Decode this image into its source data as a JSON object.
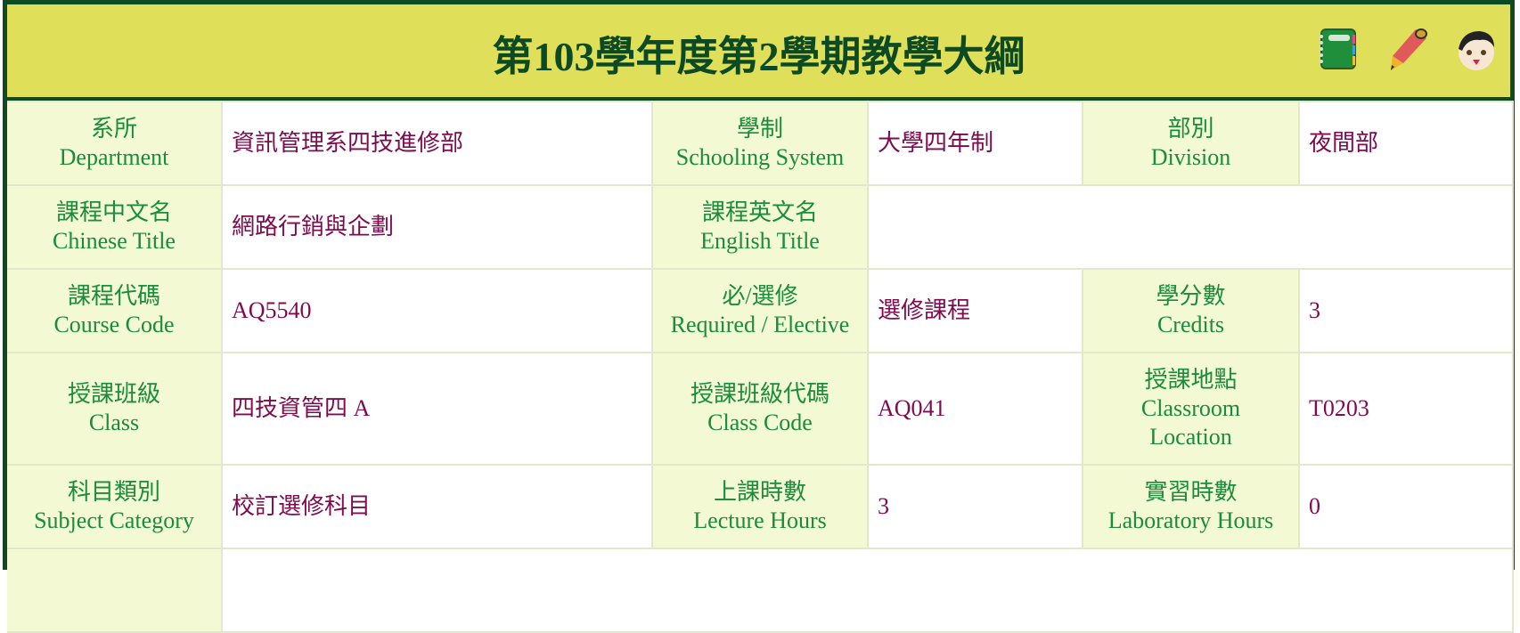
{
  "header": {
    "title": "第103學年度第2學期教學大綱",
    "icons": [
      "notebook-icon",
      "pencil-icon",
      "face-icon"
    ]
  },
  "colors": {
    "header_bg": "#dfdf5a",
    "border": "#0b4a22",
    "label": "#1a8c3c",
    "value": "#7e0b4e",
    "label_bg": "#f2f9d3"
  },
  "rows": [
    [
      {
        "zh": "系所",
        "en": "Department",
        "value": "資訊管理系四技進修部"
      },
      {
        "zh": "學制",
        "en": "Schooling System",
        "value": "大學四年制"
      },
      {
        "zh": "部別",
        "en": "Division",
        "value": "夜間部"
      }
    ],
    [
      {
        "zh": "課程中文名",
        "en": "Chinese Title",
        "value": "網路行銷與企劃"
      },
      {
        "zh": "課程英文名",
        "en": "English Title",
        "value": ""
      }
    ],
    [
      {
        "zh": "課程代碼",
        "en": "Course Code",
        "value": "AQ5540"
      },
      {
        "zh": "必/選修",
        "en": "Required / Elective",
        "value": "選修課程"
      },
      {
        "zh": "學分數",
        "en": "Credits",
        "value": "3"
      }
    ],
    [
      {
        "zh": "授課班級",
        "en": "Class",
        "value": "四技資管四 A"
      },
      {
        "zh": "授課班級代碼",
        "en": "Class Code",
        "value": "AQ041"
      },
      {
        "zh": "授課地點",
        "en": "Classroom",
        "en2": "Location",
        "value": "T0203"
      }
    ],
    [
      {
        "zh": "科目類別",
        "en": "Subject Category",
        "value": "校訂選修科目"
      },
      {
        "zh": "上課時數",
        "en": "Lecture Hours",
        "value": "3"
      },
      {
        "zh": "實習時數",
        "en": "Laboratory Hours",
        "value": "0"
      }
    ]
  ]
}
